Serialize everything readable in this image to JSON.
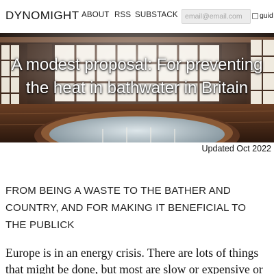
{
  "header": {
    "site_title": "DYNOMIGHT",
    "nav": {
      "about": "ABOUT",
      "rss": "RSS",
      "substack": "SUBSTACK"
    },
    "email_placeholder": "email@email.com",
    "guide_label": "guid"
  },
  "hero": {
    "title": "A modest proposal: For preventing the heat in bathwater in Britain"
  },
  "post": {
    "updated": "Updated Oct 2022",
    "subtitle": "FROM BEING A WASTE TO THE BATHER AND COUNTRY, AND FOR MAKING IT BENEFICIAL TO THE PUBLICK",
    "intro": "Europe is in an energy crisis. There are lots of things that might be done, but most are slow or expensive or"
  },
  "colors": {
    "hero_wood_dark": "#3a2418",
    "hero_wood_mid": "#7a4a2c",
    "hero_window_light": "#f2ede4",
    "hero_water": "#a9b8c0"
  },
  "icons": {
    "guide_checkbox": "checkbox-unchecked-icon"
  }
}
